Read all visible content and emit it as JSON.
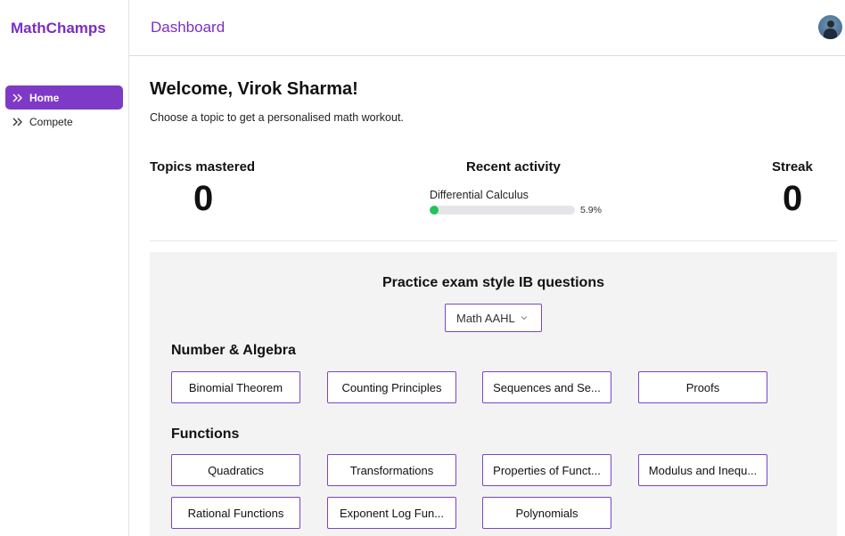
{
  "app": {
    "brand": "MathChamps"
  },
  "sidebar": {
    "items": [
      {
        "label": "Home",
        "active": true,
        "icon": "double-chevron-right-icon"
      },
      {
        "label": "Compete",
        "active": false,
        "icon": "double-chevron-right-icon"
      }
    ]
  },
  "header": {
    "title": "Dashboard",
    "avatar": "user-avatar"
  },
  "main": {
    "welcome": "Welcome, Virok Sharma!",
    "subtitle": "Choose a topic to get a personalised math workout."
  },
  "stats": {
    "topics_mastered": {
      "label": "Topics mastered",
      "value": "0"
    },
    "recent_activity": {
      "label": "Recent activity",
      "topic": "Differential Calculus",
      "percent_text": "5.9%",
      "percent": 5.9,
      "color": "#22c35a"
    },
    "streak": {
      "label": "Streak",
      "value": "0"
    }
  },
  "practice": {
    "title": "Practice exam style IB questions",
    "course_select": {
      "value": "Math AAHL",
      "icon": "chevron-down-icon"
    },
    "sections": [
      {
        "title": "Number & Algebra",
        "topics": [
          "Binomial Theorem",
          "Counting Principles",
          "Sequences and Se...",
          "Proofs"
        ]
      },
      {
        "title": "Functions",
        "topics": [
          "Quadratics",
          "Transformations",
          "Properties of Funct...",
          "Modulus and Inequ...",
          "Rational Functions",
          "Exponent Log Fun...",
          "Polynomials"
        ]
      }
    ]
  },
  "colors": {
    "accent": "#7b2fc2",
    "button_border": "#7b45c4",
    "panel_bg": "#f3f3f4"
  }
}
